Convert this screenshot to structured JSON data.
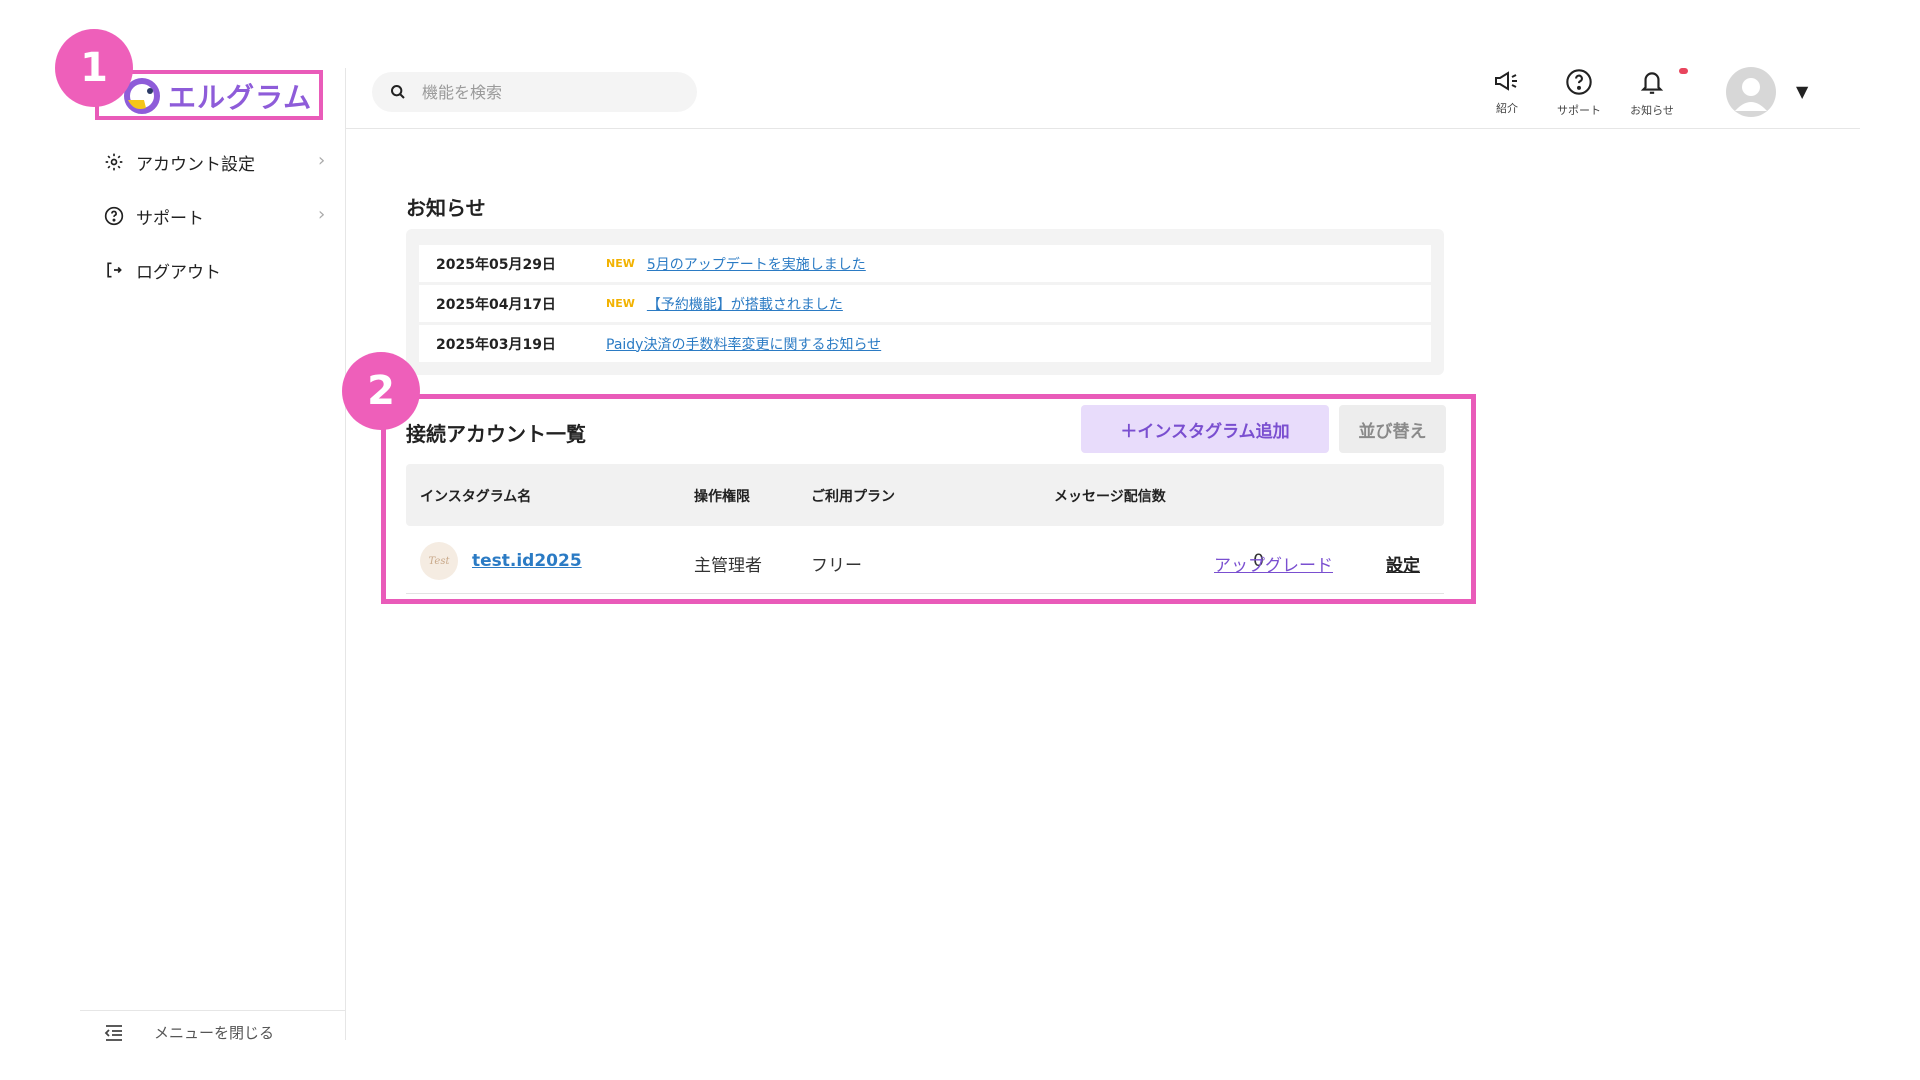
{
  "colors": {
    "accent_purple": "#8e5cd9",
    "highlight_pink": "#e95bb9",
    "link_blue": "#2b7bc4",
    "new_yellow": "#f2b200"
  },
  "badges": {
    "one": "1",
    "two": "2"
  },
  "sidebar": {
    "logo_text": "エルグラム",
    "items": [
      {
        "label": "アカウント設定",
        "icon": "gear-icon"
      },
      {
        "label": "サポート",
        "icon": "help-circle-icon"
      },
      {
        "label": "ログアウト",
        "icon": "logout-icon"
      }
    ],
    "close_menu_label": "メニューを閉じる"
  },
  "header": {
    "search_placeholder": "機能を検索",
    "icons": [
      {
        "label": "紹介",
        "icon": "megaphone-icon"
      },
      {
        "label": "サポート",
        "icon": "help-circle-icon"
      },
      {
        "label": "お知らせ",
        "icon": "bell-icon"
      }
    ]
  },
  "notices": {
    "title": "お知らせ",
    "items": [
      {
        "date": "2025年05月29日",
        "new": "NEW",
        "text": "5月のアップデートを実施しました"
      },
      {
        "date": "2025年04月17日",
        "new": "NEW",
        "text": "【予約機能】が搭載されました"
      },
      {
        "date": "2025年03月19日",
        "new": "",
        "text": "Paidy決済の手数料率変更に関するお知らせ"
      }
    ]
  },
  "accounts": {
    "title": "接続アカウント一覧",
    "add_button": "＋インスタグラム追加",
    "sort_button": "並び替え",
    "columns": [
      "インスタグラム名",
      "操作権限",
      "ご利用プラン",
      "メッセージ配信数"
    ],
    "rows": [
      {
        "avatar_text": "Test",
        "name": "test.id2025",
        "role": "主管理者",
        "plan": "フリー",
        "count": "0",
        "upgrade": "アップグレード",
        "settings": "設定"
      }
    ]
  }
}
